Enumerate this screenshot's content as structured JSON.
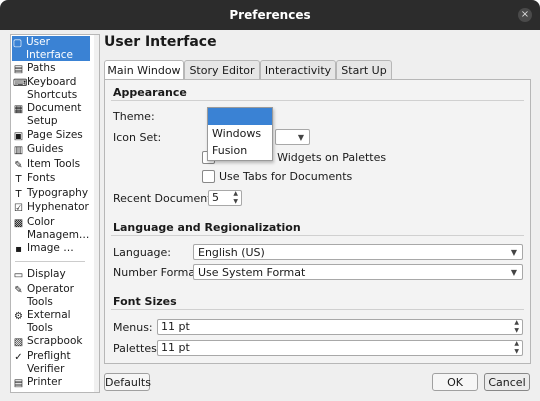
{
  "window": {
    "title": "Preferences",
    "close_glyph": "×"
  },
  "sidebar": {
    "items": [
      {
        "label": "User Interface",
        "icon": "user-interface-icon",
        "glyph": "▢"
      },
      {
        "label": "Paths",
        "icon": "paths-icon",
        "glyph": "▤"
      },
      {
        "label": "Keyboard Shortcuts",
        "icon": "keyboard-icon",
        "glyph": "⌨"
      },
      {
        "label": "Document Setup",
        "icon": "document-setup-icon",
        "glyph": "▦"
      },
      {
        "label": "Page Sizes",
        "icon": "page-sizes-icon",
        "glyph": "▣"
      },
      {
        "label": "Guides",
        "icon": "guides-icon",
        "glyph": "▥"
      },
      {
        "label": "Item Tools",
        "icon": "item-tools-icon",
        "glyph": "✎"
      },
      {
        "label": "Fonts",
        "icon": "fonts-icon",
        "glyph": "T"
      },
      {
        "label": "Typography",
        "icon": "typography-icon",
        "glyph": "T"
      },
      {
        "label": "Hyphenator",
        "icon": "hyphenator-icon",
        "glyph": "☑"
      },
      {
        "label": "Color Managem…",
        "icon": "color-management-icon",
        "glyph": "▩"
      },
      {
        "label": "Image …",
        "icon": "image-icon",
        "glyph": "▪"
      },
      {
        "label": "Display",
        "icon": "display-icon",
        "glyph": "▭"
      },
      {
        "label": "Operator Tools",
        "icon": "operator-tools-icon",
        "glyph": "✎"
      },
      {
        "label": "External Tools",
        "icon": "external-tools-icon",
        "glyph": "⚙"
      },
      {
        "label": "Scrapbook",
        "icon": "scrapbook-icon",
        "glyph": "▧"
      },
      {
        "label": "Preflight Verifier",
        "icon": "preflight-icon",
        "glyph": "✓"
      },
      {
        "label": "Printer",
        "icon": "printer-icon",
        "glyph": "▤"
      }
    ]
  },
  "main": {
    "heading": "User Interface",
    "tabs": [
      {
        "label": "Main Window"
      },
      {
        "label": "Story Editor"
      },
      {
        "label": "Interactivity"
      },
      {
        "label": "Start Up"
      }
    ],
    "appearance": {
      "title": "Appearance",
      "theme_label": "Theme:",
      "theme_options": [
        "",
        "Windows",
        "Fusion"
      ],
      "iconset_label": "Icon Set:",
      "small_widgets_label": "Use Small Widgets on Palettes",
      "tabs_docs_label": "Use Tabs for Documents",
      "recent_label": "Recent Documents:",
      "recent_value": "5"
    },
    "language": {
      "title": "Language and Regionalization",
      "language_label": "Language:",
      "language_value": "English (US)",
      "number_format_label": "Number Format:",
      "number_format_value": "Use System Format"
    },
    "font_sizes": {
      "title": "Font Sizes",
      "menus_label": "Menus:",
      "menus_value": "11 pt",
      "palettes_label": "Palettes:",
      "palettes_value": "11 pt"
    }
  },
  "buttons": {
    "defaults": "Defaults",
    "ok": "OK",
    "cancel": "Cancel"
  },
  "colors": {
    "accent": "#3a82d4",
    "titlebar": "#2c2c2c"
  }
}
